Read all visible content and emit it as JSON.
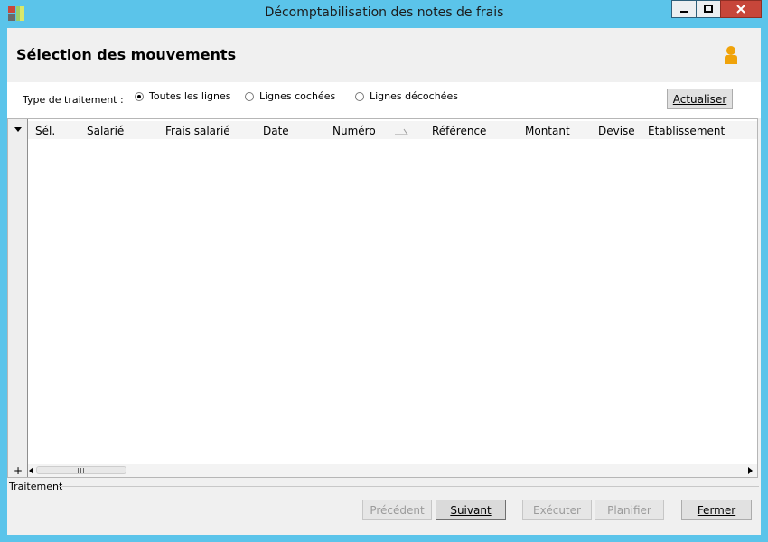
{
  "window": {
    "title": "Décomptabilisation des notes de frais"
  },
  "header": {
    "title": "Sélection des mouvements"
  },
  "filter": {
    "label": "Type de traitement :",
    "options": [
      {
        "label": "Toutes les lignes",
        "selected": true
      },
      {
        "label": "Lignes cochées",
        "selected": false
      },
      {
        "label": "Lignes décochées",
        "selected": false
      }
    ],
    "refresh_label": "Actualiser"
  },
  "grid": {
    "columns": [
      "Sél.",
      "Salarié",
      "Frais salarié",
      "Date",
      "Numéro",
      "Référence",
      "Montant",
      "Devise",
      "Etablissement"
    ],
    "rows": [],
    "add_symbol": "+"
  },
  "footer": {
    "section_label": "Traitement",
    "buttons": {
      "previous": "Précédent",
      "next": "Suivant",
      "execute": "Exécuter",
      "schedule": "Planifier",
      "close": "Fermer"
    }
  },
  "icons": {
    "app": "app-icon",
    "user": "user-icon",
    "minimize": "minimize-icon",
    "maximize": "maximize-icon",
    "close": "close-icon"
  },
  "colors": {
    "frame": "#5bc4ea",
    "close_button": "#c7463a",
    "user_icon": "#f0a30a"
  }
}
